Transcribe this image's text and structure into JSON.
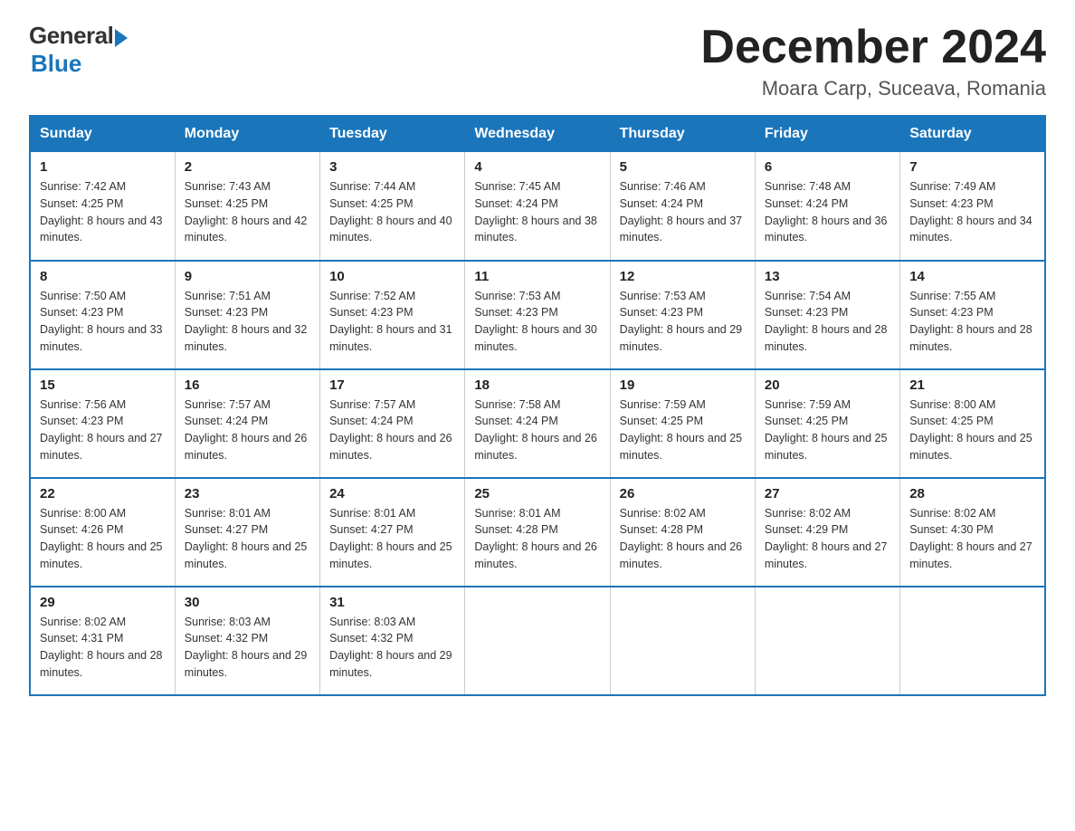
{
  "logo": {
    "general": "General",
    "blue": "Blue"
  },
  "title": "December 2024",
  "subtitle": "Moara Carp, Suceava, Romania",
  "days_of_week": [
    "Sunday",
    "Monday",
    "Tuesday",
    "Wednesday",
    "Thursday",
    "Friday",
    "Saturday"
  ],
  "weeks": [
    [
      {
        "day": "1",
        "sunrise": "7:42 AM",
        "sunset": "4:25 PM",
        "daylight": "8 hours and 43 minutes."
      },
      {
        "day": "2",
        "sunrise": "7:43 AM",
        "sunset": "4:25 PM",
        "daylight": "8 hours and 42 minutes."
      },
      {
        "day": "3",
        "sunrise": "7:44 AM",
        "sunset": "4:25 PM",
        "daylight": "8 hours and 40 minutes."
      },
      {
        "day": "4",
        "sunrise": "7:45 AM",
        "sunset": "4:24 PM",
        "daylight": "8 hours and 38 minutes."
      },
      {
        "day": "5",
        "sunrise": "7:46 AM",
        "sunset": "4:24 PM",
        "daylight": "8 hours and 37 minutes."
      },
      {
        "day": "6",
        "sunrise": "7:48 AM",
        "sunset": "4:24 PM",
        "daylight": "8 hours and 36 minutes."
      },
      {
        "day": "7",
        "sunrise": "7:49 AM",
        "sunset": "4:23 PM",
        "daylight": "8 hours and 34 minutes."
      }
    ],
    [
      {
        "day": "8",
        "sunrise": "7:50 AM",
        "sunset": "4:23 PM",
        "daylight": "8 hours and 33 minutes."
      },
      {
        "day": "9",
        "sunrise": "7:51 AM",
        "sunset": "4:23 PM",
        "daylight": "8 hours and 32 minutes."
      },
      {
        "day": "10",
        "sunrise": "7:52 AM",
        "sunset": "4:23 PM",
        "daylight": "8 hours and 31 minutes."
      },
      {
        "day": "11",
        "sunrise": "7:53 AM",
        "sunset": "4:23 PM",
        "daylight": "8 hours and 30 minutes."
      },
      {
        "day": "12",
        "sunrise": "7:53 AM",
        "sunset": "4:23 PM",
        "daylight": "8 hours and 29 minutes."
      },
      {
        "day": "13",
        "sunrise": "7:54 AM",
        "sunset": "4:23 PM",
        "daylight": "8 hours and 28 minutes."
      },
      {
        "day": "14",
        "sunrise": "7:55 AM",
        "sunset": "4:23 PM",
        "daylight": "8 hours and 28 minutes."
      }
    ],
    [
      {
        "day": "15",
        "sunrise": "7:56 AM",
        "sunset": "4:23 PM",
        "daylight": "8 hours and 27 minutes."
      },
      {
        "day": "16",
        "sunrise": "7:57 AM",
        "sunset": "4:24 PM",
        "daylight": "8 hours and 26 minutes."
      },
      {
        "day": "17",
        "sunrise": "7:57 AM",
        "sunset": "4:24 PM",
        "daylight": "8 hours and 26 minutes."
      },
      {
        "day": "18",
        "sunrise": "7:58 AM",
        "sunset": "4:24 PM",
        "daylight": "8 hours and 26 minutes."
      },
      {
        "day": "19",
        "sunrise": "7:59 AM",
        "sunset": "4:25 PM",
        "daylight": "8 hours and 25 minutes."
      },
      {
        "day": "20",
        "sunrise": "7:59 AM",
        "sunset": "4:25 PM",
        "daylight": "8 hours and 25 minutes."
      },
      {
        "day": "21",
        "sunrise": "8:00 AM",
        "sunset": "4:25 PM",
        "daylight": "8 hours and 25 minutes."
      }
    ],
    [
      {
        "day": "22",
        "sunrise": "8:00 AM",
        "sunset": "4:26 PM",
        "daylight": "8 hours and 25 minutes."
      },
      {
        "day": "23",
        "sunrise": "8:01 AM",
        "sunset": "4:27 PM",
        "daylight": "8 hours and 25 minutes."
      },
      {
        "day": "24",
        "sunrise": "8:01 AM",
        "sunset": "4:27 PM",
        "daylight": "8 hours and 25 minutes."
      },
      {
        "day": "25",
        "sunrise": "8:01 AM",
        "sunset": "4:28 PM",
        "daylight": "8 hours and 26 minutes."
      },
      {
        "day": "26",
        "sunrise": "8:02 AM",
        "sunset": "4:28 PM",
        "daylight": "8 hours and 26 minutes."
      },
      {
        "day": "27",
        "sunrise": "8:02 AM",
        "sunset": "4:29 PM",
        "daylight": "8 hours and 27 minutes."
      },
      {
        "day": "28",
        "sunrise": "8:02 AM",
        "sunset": "4:30 PM",
        "daylight": "8 hours and 27 minutes."
      }
    ],
    [
      {
        "day": "29",
        "sunrise": "8:02 AM",
        "sunset": "4:31 PM",
        "daylight": "8 hours and 28 minutes."
      },
      {
        "day": "30",
        "sunrise": "8:03 AM",
        "sunset": "4:32 PM",
        "daylight": "8 hours and 29 minutes."
      },
      {
        "day": "31",
        "sunrise": "8:03 AM",
        "sunset": "4:32 PM",
        "daylight": "8 hours and 29 minutes."
      },
      null,
      null,
      null,
      null
    ]
  ]
}
